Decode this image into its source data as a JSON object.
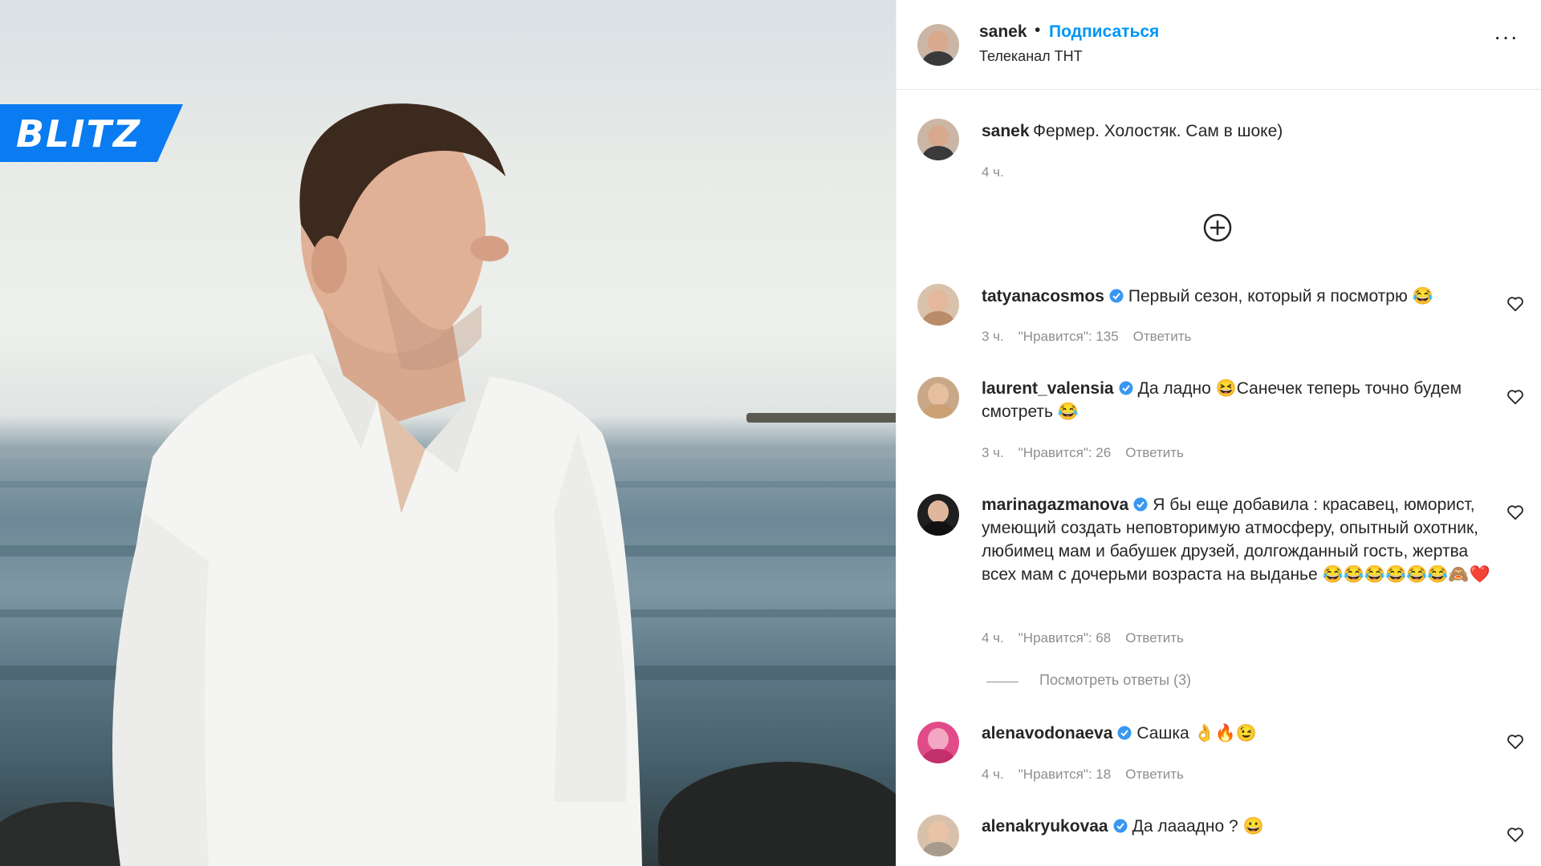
{
  "watermark": {
    "brand": "BLITZ",
    "accent": "#0a7bf0"
  },
  "post": {
    "username": "sanek",
    "follow_label": "Подписаться",
    "location": "Телеканал ТНТ",
    "more_icon": "ellipsis-icon",
    "caption_user": "sanek",
    "caption_text": "Фермер. Холостяк. Сам в шоке)",
    "caption_time": "4 ч."
  },
  "comments": [
    {
      "user": "tatyanacosmos",
      "text": "Первый сезон, который я посмотрю 😂",
      "time": "3 ч.",
      "likes": "\"Нравится\": 135",
      "reply": "Ответить"
    },
    {
      "user": "laurent_valensia",
      "text": "Да ладно 😆Санечек теперь точно будем смотреть 😂",
      "time": "3 ч.",
      "likes": "\"Нравится\": 26",
      "reply": "Ответить"
    },
    {
      "user": "marinagazmanova",
      "text": "Я бы еще добавила : красавец, юморист, умеющий создать неповторимую атмосферу, опытный охотник, любимец мам и бабушек друзей, долгожданный гость, жертва всех мам с дочерьми возраста на выданье 😂😂😂😂😂😂🙈❤️",
      "time": "4 ч.",
      "likes": "\"Нравится\": 68",
      "reply": "Ответить"
    },
    {
      "user": "alenavodonaeva",
      "text": "Сашка 👌🔥😉",
      "time": "4 ч.",
      "likes": "\"Нравится\": 18",
      "reply": "Ответить"
    },
    {
      "user": "alenakryukovaa",
      "text": "Да лааадно ? 😀",
      "time": "",
      "likes": "",
      "reply": ""
    }
  ],
  "view_replies": "Посмотреть ответы (3)",
  "colors": {
    "link": "#0095f6",
    "meta": "#8e8e8e",
    "verified": "#3897f0"
  }
}
